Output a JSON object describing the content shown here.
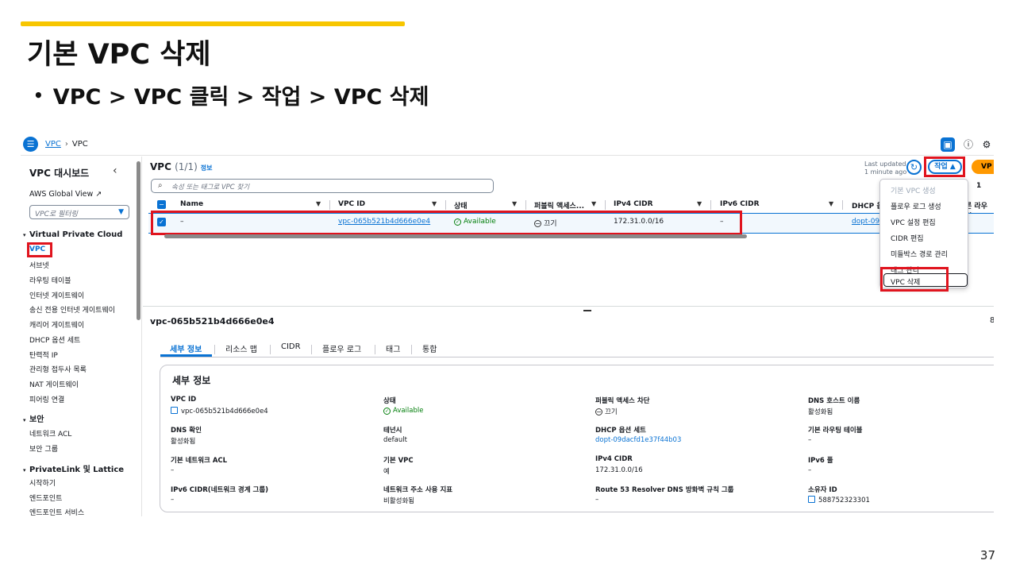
{
  "slide": {
    "title": "기본 VPC 삭제",
    "bullet": "VPC > VPC 클릭 > 작업 > VPC 삭제",
    "page_number": "37",
    "accent_color": "#f7c600"
  },
  "console": {
    "breadcrumb": {
      "link": "VPC",
      "current": "VPC"
    },
    "sidebar": {
      "title": "VPC 대시보드",
      "global_view": "AWS Global View ↗",
      "filter_placeholder": "VPC로 필터링",
      "sections": {
        "vpc": "Virtual Private Cloud",
        "security": "보안",
        "privatelink": "PrivateLink 및 Lattice"
      },
      "vpc_items": [
        "VPC",
        "서브넷",
        "라우팅 테이블",
        "인터넷 게이트웨이",
        "송신 전용 인터넷 게이트웨이",
        "캐리어 게이트웨이",
        "DHCP 옵션 세트",
        "탄력적 IP",
        "관리형 접두사 목록",
        "NAT 게이트웨이",
        "피어링 연결"
      ],
      "security_items": [
        "네트워크 ACL",
        "보안 그룹"
      ],
      "privatelink_items": [
        "시작하기",
        "엔드포인트",
        "엔드포인트 서비스"
      ]
    },
    "table": {
      "title": "VPC",
      "count": "(1/1)",
      "info": "정보",
      "last_updated_1": "Last updated",
      "last_updated_2": "1 minute ago",
      "actions_label": "작업 ▲",
      "create_label": "VP",
      "search_placeholder": "속성 또는 태그로 VPC 찾기",
      "pager": "1",
      "columns": [
        "Name",
        "VPC ID",
        "상태",
        "퍼블릭 액세스...",
        "IPv4 CIDR",
        "IPv6 CIDR",
        "DHCP 옵",
        "른 라우팅"
      ],
      "row": {
        "name": "–",
        "vpc_id": "vpc-065b521b4d666e0e4",
        "status": "Available",
        "public_access": "끄기",
        "ipv4": "172.31.0.0/16",
        "ipv6": "–",
        "dhcp": "dopt-09"
      }
    },
    "actions_menu": [
      "기본 VPC 생성",
      "플로우 로그 생성",
      "VPC 설정 편집",
      "CIDR 편집",
      "미들박스 경로 관리",
      "태그 관리",
      "VPC 삭제"
    ],
    "details": {
      "vpc_id": "vpc-065b521b4d666e0e4",
      "right_mark": "8",
      "tabs": [
        "세부 정보",
        "리소스 맵",
        "CIDR",
        "플로우 로그",
        "태그",
        "통합"
      ],
      "box_title": "세부 정보",
      "fields": [
        {
          "label": "VPC ID",
          "value": "vpc-065b521b4d666e0e4"
        },
        {
          "label": "상태",
          "value": "Available"
        },
        {
          "label": "퍼블릭 액세스 차단",
          "value": "끄기"
        },
        {
          "label": "DNS 호스트 이름",
          "value": "활성화됨"
        },
        {
          "label": "DNS 확인",
          "value": "활성화됨"
        },
        {
          "label": "테넌시",
          "value": "default"
        },
        {
          "label": "DHCP 옵션 세트",
          "value": "dopt-09dacfd1e37f44b03"
        },
        {
          "label": "기본 라우팅 테이블",
          "value": "–"
        },
        {
          "label": "기본 네트워크 ACL",
          "value": "–"
        },
        {
          "label": "기본 VPC",
          "value": "예"
        },
        {
          "label": "IPv4 CIDR",
          "value": "172.31.0.0/16"
        },
        {
          "label": "IPv6 풀",
          "value": "–"
        },
        {
          "label": "IPv6 CIDR(네트워크 경계 그룹)",
          "value": "–"
        },
        {
          "label": "네트워크 주소 사용 지표",
          "value": "비활성화됨"
        },
        {
          "label": "Route 53 Resolver DNS 방화벽 규칙 그룹",
          "value": "–"
        },
        {
          "label": "소유자 ID",
          "value": "588752323301"
        }
      ]
    },
    "colors": {
      "accent_blue": "#0972d3",
      "success_green": "#037f0c",
      "highlight_red": "#e0141e",
      "primary_orange": "#ff9900"
    }
  }
}
